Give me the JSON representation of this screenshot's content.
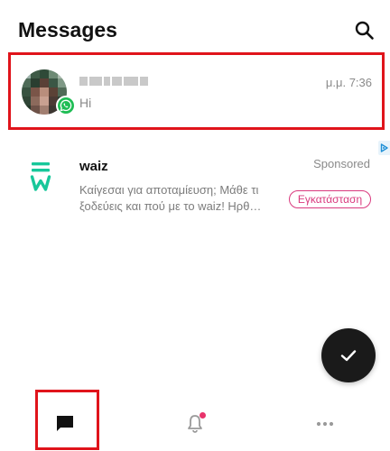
{
  "header": {
    "title": "Messages",
    "search_icon": "search-icon"
  },
  "conversations": [
    {
      "name": "",
      "time": "μ.μ. 7:36",
      "preview": "Hi",
      "source_icon": "whatsapp-icon"
    }
  ],
  "ad": {
    "brand": "waiz",
    "label": "Sponsored",
    "text": "Καίγεσαι για αποταμίευση; Μάθε τι ξοδεύεις και πού με το waiz! Ηρθ…",
    "cta": "Εγκατάσταση",
    "adchoices_icon": "adchoices-icon"
  },
  "fab": {
    "icon": "checkmark-icon"
  },
  "bottom_nav": [
    {
      "icon": "chat-icon",
      "selected": true
    },
    {
      "icon": "bell-icon",
      "badge": true
    },
    {
      "icon": "more-icon"
    }
  ],
  "colors": {
    "highlight": "#e0141b",
    "whatsapp": "#1ebd54",
    "ad_accent": "#d93a7e",
    "waiz": "#18c79a",
    "notif_dot": "#e8336b",
    "fab": "#1a1a1a"
  }
}
